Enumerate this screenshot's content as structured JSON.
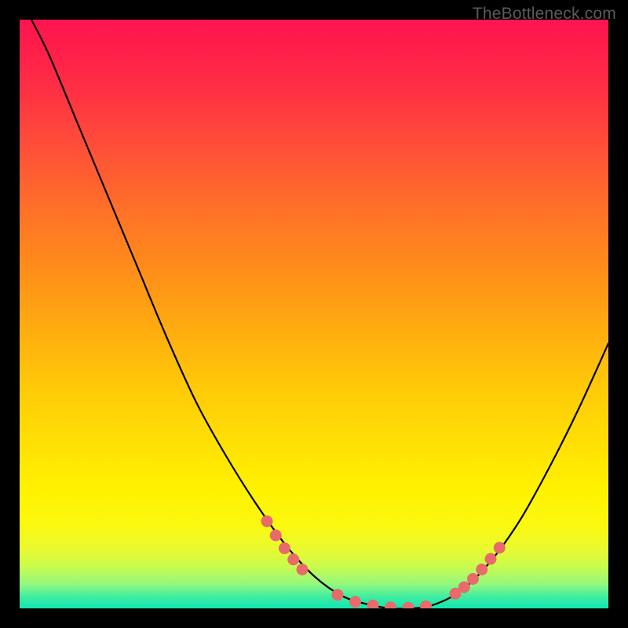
{
  "watermark": "TheBottleneck.com",
  "chart_data": {
    "type": "line",
    "title": "",
    "xlabel": "",
    "ylabel": "",
    "xlim": [
      0,
      100
    ],
    "ylim": [
      0,
      100
    ],
    "series": [
      {
        "name": "bottleneck-curve",
        "x": [
          2,
          5,
          10,
          15,
          20,
          25,
          30,
          35,
          40,
          45,
          50,
          55,
          60,
          63,
          66,
          70,
          75,
          80,
          85,
          90,
          95,
          100
        ],
        "y": [
          100,
          94,
          82,
          70,
          58,
          46,
          35,
          26,
          18,
          11,
          5.5,
          2,
          0.5,
          0,
          0,
          0.5,
          3,
          8,
          15,
          24,
          34,
          45
        ]
      }
    ],
    "markers": {
      "name": "highlight-dots",
      "color": "#e96a6a",
      "radius_px": 7.5,
      "points": [
        {
          "x": 42,
          "y": 14.8
        },
        {
          "x": 43.5,
          "y": 12.4
        },
        {
          "x": 45,
          "y": 10.2
        },
        {
          "x": 46.5,
          "y": 8.3
        },
        {
          "x": 48,
          "y": 6.6
        },
        {
          "x": 54,
          "y": 2.3
        },
        {
          "x": 57,
          "y": 1.1
        },
        {
          "x": 60,
          "y": 0.5
        },
        {
          "x": 63,
          "y": 0.15
        },
        {
          "x": 66,
          "y": 0.1
        },
        {
          "x": 69,
          "y": 0.35
        },
        {
          "x": 74,
          "y": 2.5
        },
        {
          "x": 75.5,
          "y": 3.6
        },
        {
          "x": 77,
          "y": 5.0
        },
        {
          "x": 78.5,
          "y": 6.6
        },
        {
          "x": 80,
          "y": 8.4
        },
        {
          "x": 81.5,
          "y": 10.3
        }
      ]
    }
  }
}
